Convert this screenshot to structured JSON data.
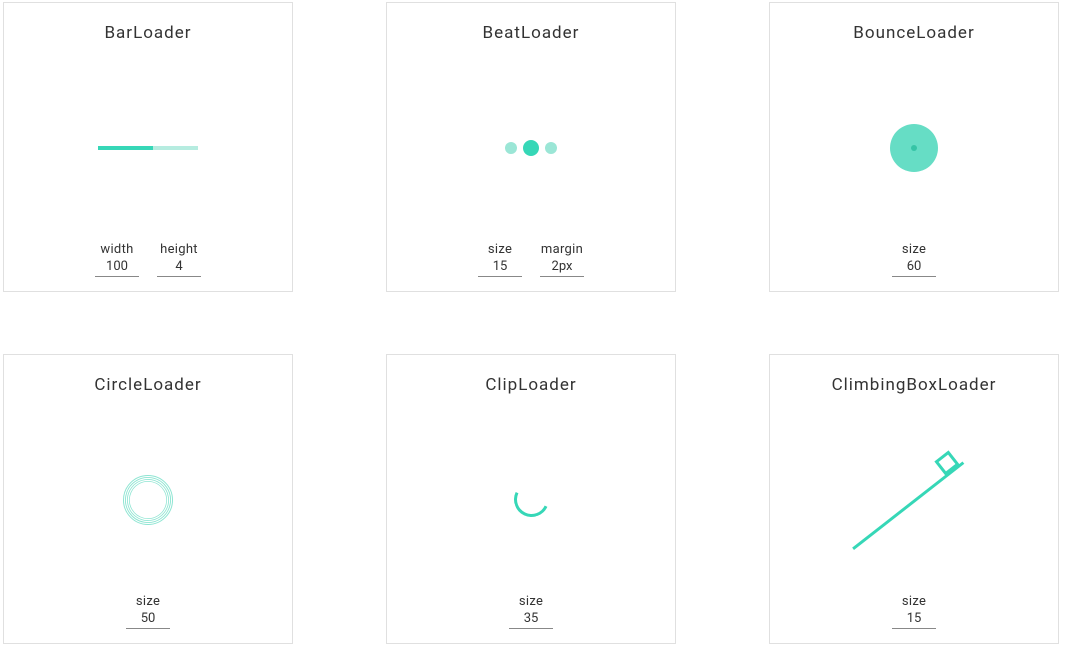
{
  "accent": "#36d7b7",
  "cards": [
    {
      "id": "bar-loader",
      "title": "BarLoader",
      "controls": [
        {
          "label": "width",
          "value": "100"
        },
        {
          "label": "height",
          "value": "4"
        }
      ]
    },
    {
      "id": "beat-loader",
      "title": "BeatLoader",
      "controls": [
        {
          "label": "size",
          "value": "15"
        },
        {
          "label": "margin",
          "value": "2px"
        }
      ]
    },
    {
      "id": "bounce-loader",
      "title": "BounceLoader",
      "controls": [
        {
          "label": "size",
          "value": "60"
        }
      ]
    },
    {
      "id": "circle-loader",
      "title": "CircleLoader",
      "controls": [
        {
          "label": "size",
          "value": "50"
        }
      ]
    },
    {
      "id": "clip-loader",
      "title": "ClipLoader",
      "controls": [
        {
          "label": "size",
          "value": "35"
        }
      ]
    },
    {
      "id": "climbing-box-loader",
      "title": "ClimbingBoxLoader",
      "controls": [
        {
          "label": "size",
          "value": "15"
        }
      ]
    }
  ]
}
